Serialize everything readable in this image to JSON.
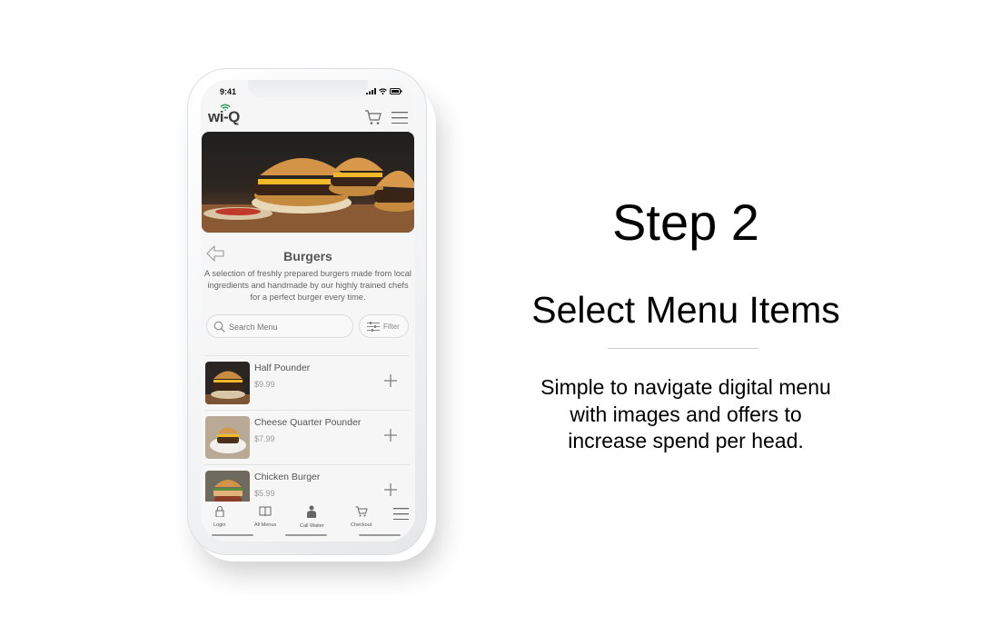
{
  "phone": {
    "status_time": "9:41",
    "brand_logo": "wi-Q",
    "header_icons": [
      "cart-icon",
      "hamburger-menu-icon"
    ],
    "category": {
      "title": "Burgers",
      "description": "A selection of freshly prepared burgers made from local ingredients and handmade by our highly trained chefs for a perfect burger every time."
    },
    "search": {
      "placeholder": "Search Menu",
      "value": ""
    },
    "filter_label": "Filter",
    "items": [
      {
        "name": "Half Pounder",
        "price": "$9.99"
      },
      {
        "name": "Cheese Quarter Pounder",
        "price": "$7.99"
      },
      {
        "name": "Chicken Burger",
        "price": "$5.99"
      }
    ],
    "bottom_nav": [
      {
        "label": "Login",
        "icon": "lock-icon"
      },
      {
        "label": "All Menus",
        "icon": "book-icon"
      },
      {
        "label": "Call Waiter",
        "icon": "waiter-icon"
      },
      {
        "label": "Checkout",
        "icon": "cart-icon"
      },
      {
        "label": "",
        "icon": "hamburger-menu-icon"
      }
    ]
  },
  "promo": {
    "step": "Step 2",
    "title": "Select Menu Items",
    "description_lines": [
      "Simple to navigate digital menu",
      "with images and offers to",
      "increase spend per head."
    ]
  },
  "colors": {
    "brand_green": "#2f9a6a",
    "text_gray": "#555555",
    "background": "#ffffff"
  }
}
